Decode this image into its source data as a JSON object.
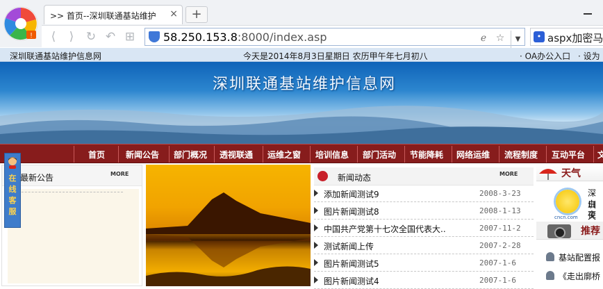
{
  "browser": {
    "tab_title": ">> 首页--深圳联通基站维护",
    "tab_close": "×",
    "new_tab": "+",
    "url_host": "58.250.153.8",
    "url_rest": ":8000/index.asp",
    "search_query": "aspx加密马"
  },
  "topbar": {
    "site_name": "深圳联通基站维护信息网",
    "date_text": "今天是2014年8月3日星期日 农历甲午年七月初八",
    "oa_link": "· OA办公入口",
    "homepage_link": "· 设为"
  },
  "banner": {
    "title": "深圳联通基站维护信息网"
  },
  "nav": {
    "items": [
      "首页",
      "新闻公告",
      "部门概况",
      "透视联通",
      "运维之窗",
      "培训信息",
      "部门活动",
      "节能降耗",
      "网络运维",
      "流程制度",
      "互动平台",
      "文"
    ]
  },
  "kefu": {
    "label": "在线客服"
  },
  "notice": {
    "title": "最新公告",
    "more": "MORE"
  },
  "news": {
    "title": "新闻动态",
    "more": "MORE",
    "rows": [
      {
        "title": "添加新闻测试9",
        "date": "2008-3-23"
      },
      {
        "title": "图片新闻测试8",
        "date": "2008-1-13"
      },
      {
        "title": "中国共产党第十七次全国代表大..",
        "date": "2007-11-2"
      },
      {
        "title": "测试新闻上传",
        "date": "2007-2-28"
      },
      {
        "title": "图片新闻测试5",
        "date": "2007-1-6"
      },
      {
        "title": "图片新闻测试4",
        "date": "2007-1-6"
      }
    ]
  },
  "weather": {
    "title": "天气",
    "city": "深圳",
    "day": "白天",
    "night": "夜晚",
    "source": "cncn.com"
  },
  "recommend": {
    "title": "推荐",
    "items": [
      "基站配置报",
      "《走出廓桥"
    ]
  }
}
